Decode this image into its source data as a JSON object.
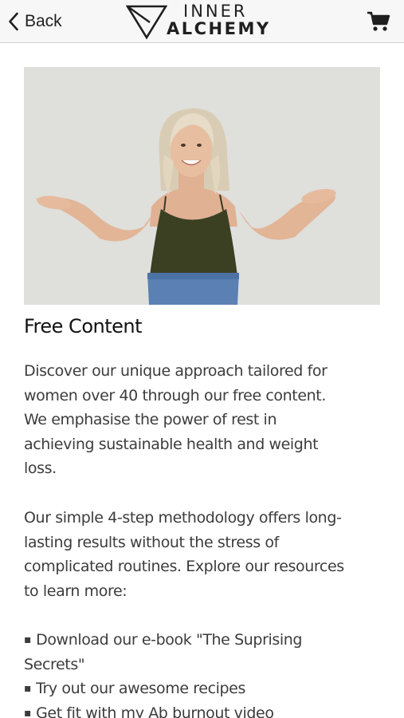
{
  "navbar": {
    "back_label": "Back",
    "back_icon": "chevron-left-icon",
    "logo_line1": "INNER",
    "logo_line2": "ALCHEMY",
    "logo_mark": "triangle-logo-icon",
    "cart_icon": "cart-icon"
  },
  "content": {
    "title": "Free Content",
    "paragraph1_lines": [
      "Discover our unique approach tailored for",
      "women over 40 through our free content.",
      "We emphasise the power of rest in",
      "achieving sustainable health and weight",
      "loss."
    ],
    "paragraph2_lines": [
      "Our simple 4-step methodology offers long-",
      "lasting results without the stress of",
      "complicated routines. Explore our resources",
      "to learn more:"
    ],
    "list_items": [
      {
        "lines": [
          "Download our e-book \"The Suprising",
          "Secrets\""
        ]
      },
      {
        "lines": [
          "Try out our awesome recipes"
        ]
      },
      {
        "lines": [
          "Get fit with my Ab burnout video"
        ]
      }
    ],
    "bullet": "▪"
  },
  "colors": {
    "navbar_bg": "#f7f7f7",
    "text": "#3c3c3c",
    "heading": "#111111"
  }
}
